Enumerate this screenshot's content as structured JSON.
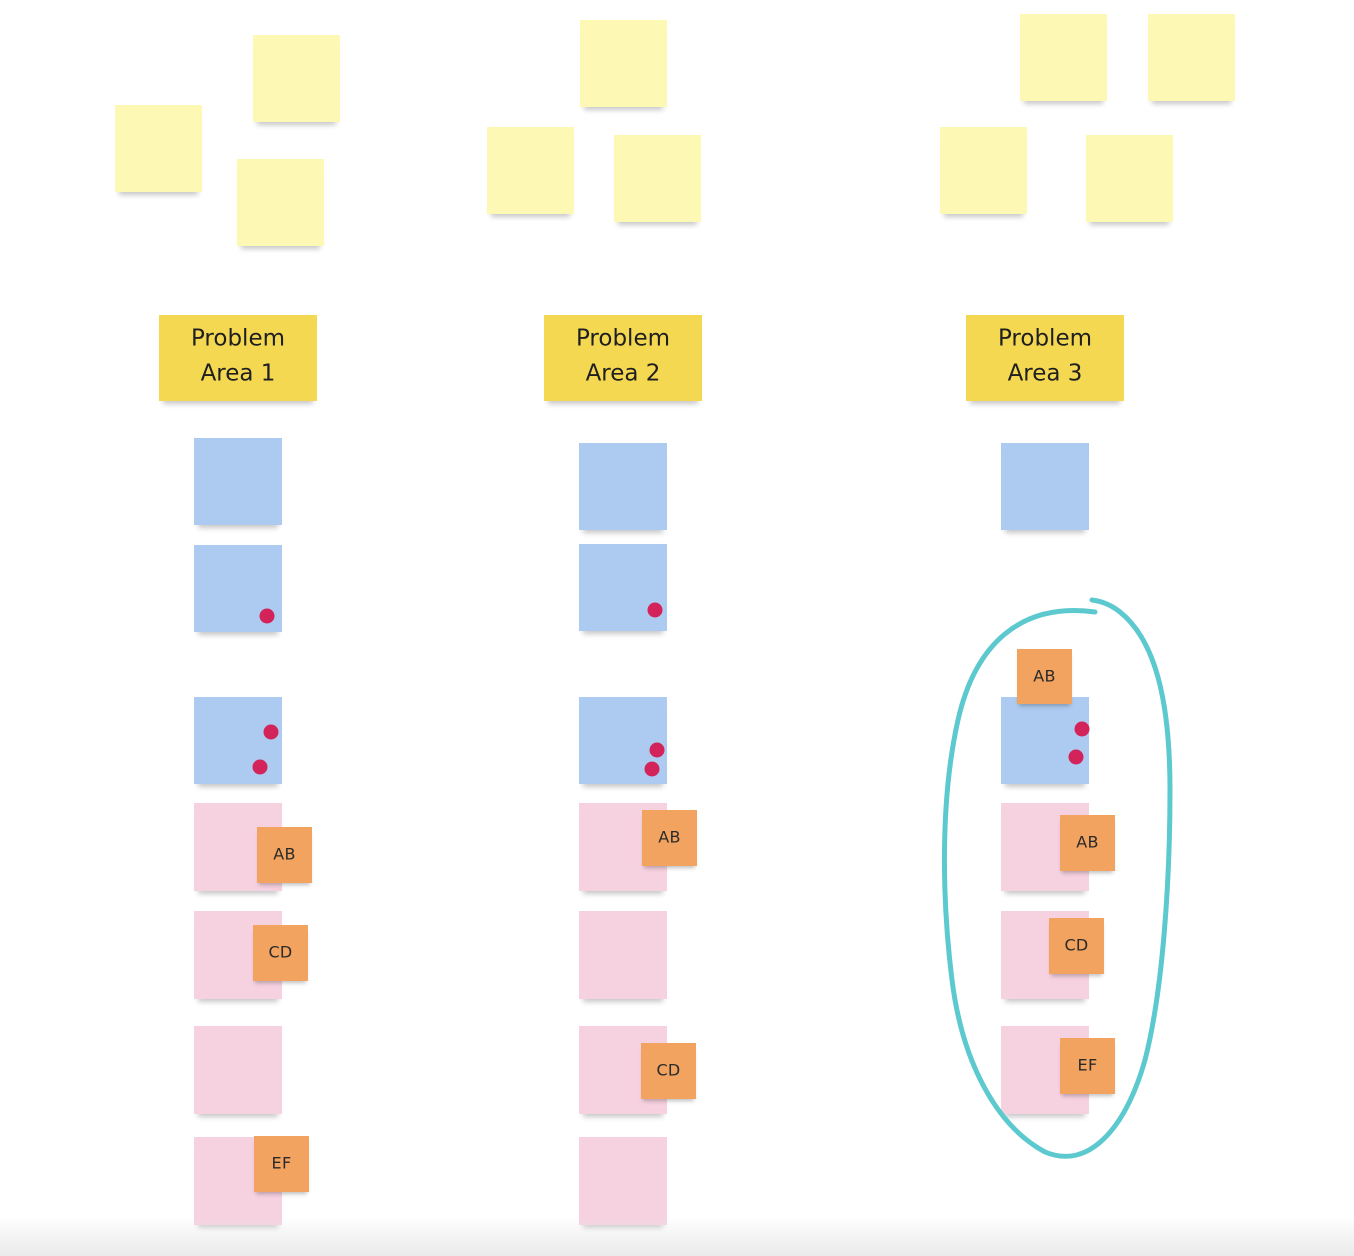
{
  "board": {
    "columns": [
      {
        "header": "Problem\nArea 1",
        "ideas": 3,
        "blue_votes": [
          0,
          1,
          2
        ],
        "pink_tags": [
          "AB",
          "CD",
          "",
          "EF"
        ]
      },
      {
        "header": "Problem\nArea 2",
        "ideas": 3,
        "blue_votes": [
          0,
          1,
          2
        ],
        "pink_tags": [
          "AB",
          "",
          "CD",
          ""
        ]
      },
      {
        "header": "Problem\nArea 3",
        "ideas": 4,
        "blue_votes": [
          0,
          2
        ],
        "blue_tags": [
          "",
          "AB"
        ],
        "pink_tags": [
          "AB",
          "CD",
          "EF"
        ],
        "circled": true
      }
    ]
  },
  "colors": {
    "idea_yellow": "#fdf8b4",
    "header_yellow": "#f4d852",
    "blue": "#adcbf0",
    "pink": "#f6d1e0",
    "orange": "#f2a35f",
    "dot": "#d2245a",
    "circle": "#5cc9cf"
  }
}
